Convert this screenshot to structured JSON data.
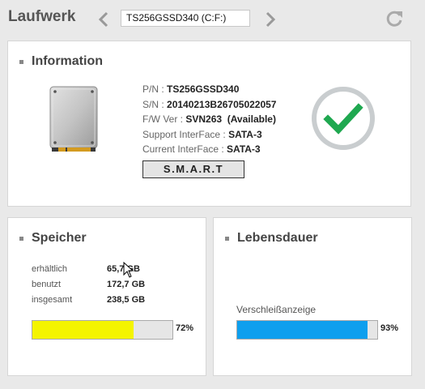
{
  "header": {
    "title": "Laufwerk",
    "drive_selector": "TS256GSSD340 (C:F:)"
  },
  "info": {
    "title": "Information",
    "rows": [
      {
        "label": "P/N : ",
        "value": "TS256GSSD340"
      },
      {
        "label": "S/N : ",
        "value": "20140213B26705022057"
      },
      {
        "label": "F/W Ver : ",
        "value": "SVN263  (Available)"
      },
      {
        "label": "Support InterFace : ",
        "value": "SATA-3"
      },
      {
        "label": "Current InterFace : ",
        "value": "SATA-3"
      }
    ],
    "smart_button": "S.M.A.R.T",
    "status_icon": "check-circle-icon"
  },
  "storage": {
    "title": "Speicher",
    "rows": [
      {
        "label": "erhältlich",
        "value": "65,7 GB"
      },
      {
        "label": "benutzt",
        "value": "172,7 GB"
      },
      {
        "label": "insgesamt",
        "value": "238,5 GB"
      }
    ],
    "usage_percent": 72,
    "usage_label": "72%",
    "bar_color": "#f4f400"
  },
  "lifespan": {
    "title": "Lebensdauer",
    "wear_label": "Verschleißanzeige",
    "wear_percent": 93,
    "wear_label_percent": "93%",
    "bar_color": "#0e9fee"
  }
}
